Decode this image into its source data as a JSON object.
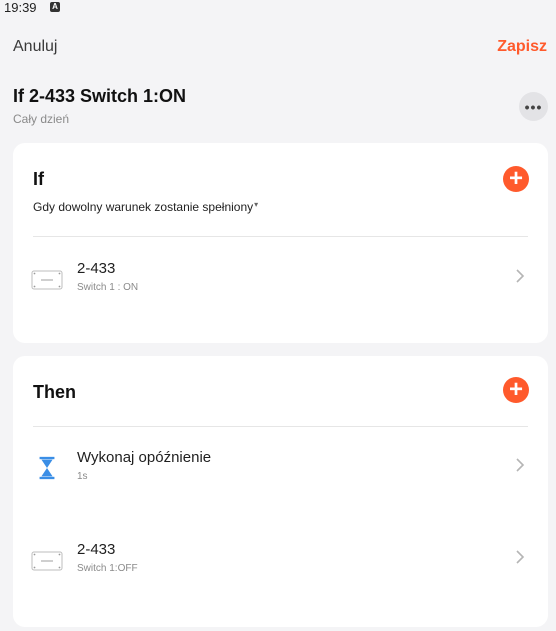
{
  "status_bar": {
    "time": "19:39",
    "notification_glyph": "A"
  },
  "header": {
    "cancel_label": "Anuluj",
    "save_label": "Zapisz"
  },
  "scene": {
    "title": "If 2-433 Switch 1:ON",
    "schedule": "Cały dzień",
    "more_label": "•••"
  },
  "if_section": {
    "title": "If",
    "add_label": "+",
    "condition_mode": "Gdy dowolny warunek zostanie spełniony",
    "items": [
      {
        "name": "2-433",
        "detail": "Switch 1 : ON",
        "icon": "device-switch-icon"
      }
    ]
  },
  "then_section": {
    "title": "Then",
    "add_label": "+",
    "items": [
      {
        "name": "Wykonaj opóźnienie",
        "detail": "1s",
        "icon": "hourglass-icon"
      },
      {
        "name": "2-433",
        "detail": "Switch 1:OFF",
        "icon": "device-switch-icon"
      }
    ]
  },
  "colors": {
    "accent": "#ff5a2c",
    "hourglass": "#3a8ee6",
    "background": "#f4f4f6"
  }
}
